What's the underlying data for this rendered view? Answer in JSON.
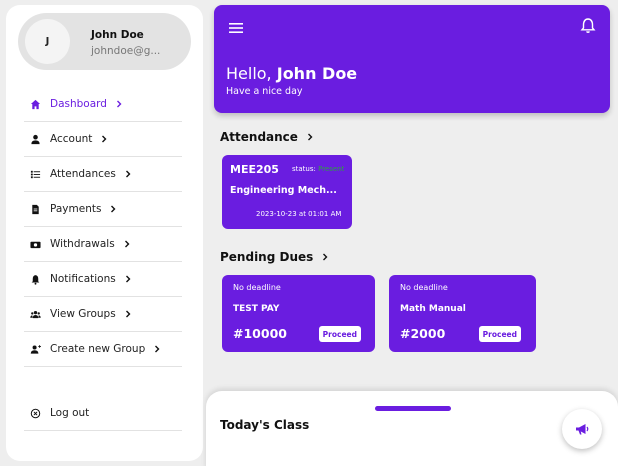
{
  "colors": {
    "accent": "#6a1de0",
    "status_ok": "#2ea043",
    "background": "#eeeeee"
  },
  "profile": {
    "initial": "J",
    "name": "John Doe",
    "email": "johndoe@g..."
  },
  "nav": {
    "items": [
      {
        "label": "Dashboard",
        "icon": "home-icon"
      },
      {
        "label": "Account",
        "icon": "person-icon"
      },
      {
        "label": "Attendances",
        "icon": "list-icon"
      },
      {
        "label": "Payments",
        "icon": "receipt-icon"
      },
      {
        "label": "Withdrawals",
        "icon": "money-icon"
      },
      {
        "label": "Notifications",
        "icon": "bell-icon"
      },
      {
        "label": "View Groups",
        "icon": "group-icon"
      },
      {
        "label": "Create new Group",
        "icon": "add-person-icon"
      }
    ],
    "logout": "Log out"
  },
  "header": {
    "hello": "Hello,",
    "name": "John Doe",
    "subtitle": "Have a nice day"
  },
  "attendance": {
    "title": "Attendance",
    "card": {
      "code": "MEE205",
      "status_label": "status:",
      "status_value": "Present",
      "course": "Engineering Mech...",
      "date": "2023-10-23 at 01:01 AM"
    }
  },
  "dues": {
    "title": "Pending Dues",
    "items": [
      {
        "deadline": "No deadline",
        "name": "TEST PAY",
        "amount": "#10000",
        "action": "Proceed"
      },
      {
        "deadline": "No deadline",
        "name": "Math Manual",
        "amount": "#2000",
        "action": "Proceed"
      }
    ]
  },
  "today": {
    "title": "Today's Class"
  }
}
